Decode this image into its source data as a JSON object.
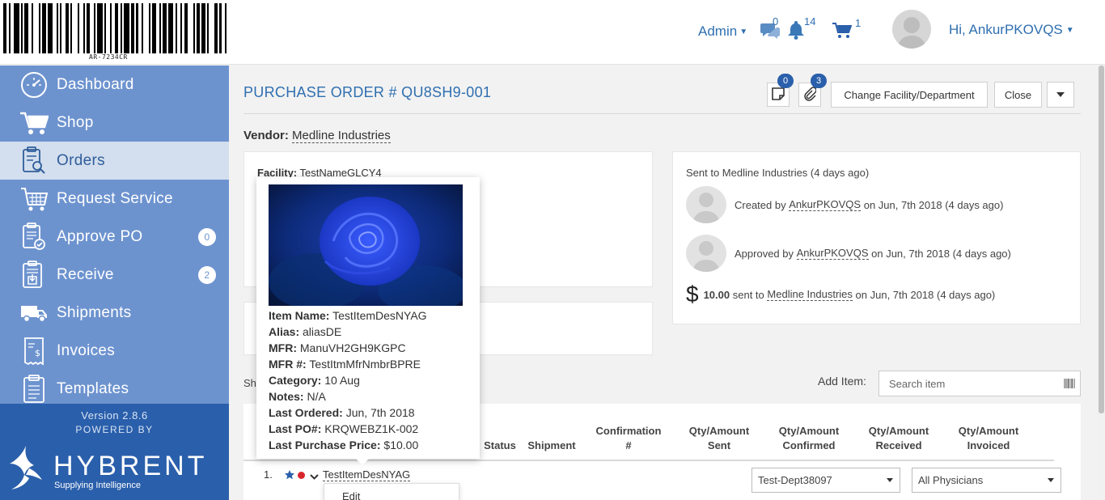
{
  "header": {
    "barcode_text": "AR-7234CR",
    "admin_label": "Admin",
    "chat_count": "0",
    "bell_count": "14",
    "cart_count": "1",
    "greeting": "Hi, AnkurPKOVQS"
  },
  "sidebar": {
    "items": [
      {
        "label": "Dashboard",
        "icon": "dashboard-icon"
      },
      {
        "label": "Shop",
        "icon": "cart-icon"
      },
      {
        "label": "Orders",
        "icon": "orders-icon"
      },
      {
        "label": "Request Service",
        "icon": "request-service-icon"
      },
      {
        "label": "Approve PO",
        "icon": "approve-icon",
        "badge": "0"
      },
      {
        "label": "Receive",
        "icon": "receive-icon",
        "badge": "2"
      },
      {
        "label": "Shipments",
        "icon": "truck-icon"
      },
      {
        "label": "Invoices",
        "icon": "invoice-icon"
      },
      {
        "label": "Templates",
        "icon": "template-icon"
      }
    ],
    "version": "Version 2.8.6",
    "powered_by": "POWERED BY",
    "brand": "HYBRENT",
    "tagline": "Supplying Intelligence"
  },
  "main": {
    "po_title": "PURCHASE ORDER # QU8SH9-001",
    "notes_count": "0",
    "attachments_count": "3",
    "change_facility_label": "Change Facility/Department",
    "close_label": "Close",
    "vendor_label": "Vendor:",
    "vendor_name": "Medline Industries",
    "facility_label": "Facility:",
    "facility_value": "TestNameGLCY4",
    "activity": {
      "sent_line": "Sent to Medline Industries (4 days ago)",
      "created_prefix": "Created by",
      "created_user": "AnkurPKOVQS",
      "created_suffix": "on Jun, 7th 2018 (4 days ago)",
      "approved_prefix": "Approved by",
      "approved_user": "AnkurPKOVQS",
      "approved_suffix": "on Jun, 7th 2018 (4 days ago)",
      "amount": "10.00",
      "amount_mid": "sent to",
      "amount_vendor": "Medline Industries",
      "amount_suffix": "on Jun, 7th 2018 (4 days ago)"
    },
    "ship_label": "Sh",
    "add_item_label": "Add Item:",
    "search_placeholder": "Search item",
    "columns": {
      "status": "Status",
      "shipment": "Shipment",
      "confirmation_1": "Confirmation",
      "confirmation_2": "#",
      "sent_1": "Qty/Amount",
      "sent_2": "Sent",
      "confirmed_1": "Qty/Amount",
      "confirmed_2": "Confirmed",
      "received_1": "Qty/Amount",
      "received_2": "Received",
      "invoiced_1": "Qty/Amount",
      "invoiced_2": "Invoiced"
    },
    "row": {
      "number": "1.",
      "item_name": "TestItemDesNYAG",
      "department": "Test-Dept38097",
      "physician": "All Physicians",
      "menu_edit": "Edit"
    }
  },
  "popover": {
    "image": "blue-rose-photo",
    "lines": [
      {
        "label": "Item Name:",
        "value": "TestItemDesNYAG"
      },
      {
        "label": "Alias:",
        "value": "aliasDE"
      },
      {
        "label": "MFR:",
        "value": "ManuVH2GH9KGPC"
      },
      {
        "label": "MFR #:",
        "value": "TestItmMfrNmbrBPRE"
      },
      {
        "label": "Category:",
        "value": "10 Aug"
      },
      {
        "label": "Notes:",
        "value": "N/A"
      },
      {
        "label": "Last Ordered:",
        "value": "Jun, 7th 2018"
      },
      {
        "label": "Last PO#:",
        "value": "KRQWEBZ1K-002"
      },
      {
        "label": "Last Purchase Price:",
        "value": "$10.00"
      }
    ]
  },
  "colors": {
    "sidebar": "#6d93cf",
    "sidebar_active": "#d3deee",
    "sidebar_bottom": "#2a5fab",
    "link_blue": "#2f6fb0",
    "star": "#2a5fab",
    "dot": "#d9262c"
  }
}
